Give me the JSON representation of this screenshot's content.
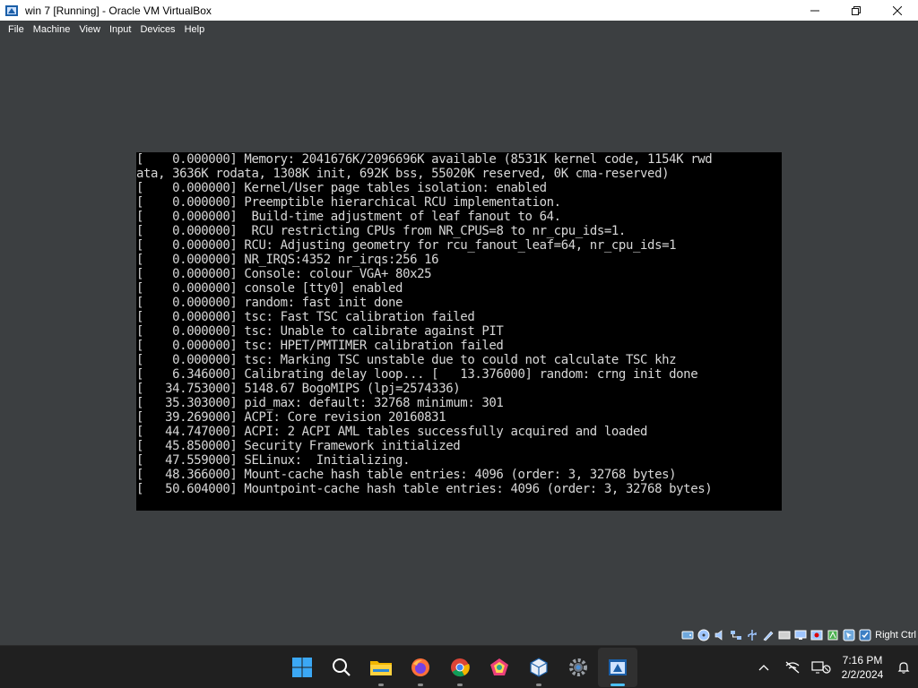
{
  "window": {
    "title": "win 7 [Running] - Oracle VM VirtualBox",
    "controls": [
      "minimize-icon",
      "restore-icon",
      "close-icon"
    ]
  },
  "menu": [
    "File",
    "Machine",
    "View",
    "Input",
    "Devices",
    "Help"
  ],
  "console": {
    "lines": [
      "[    0.000000] Memory: 2041676K/2096696K available (8531K kernel code, 1154K rwd",
      "ata, 3636K rodata, 1308K init, 692K bss, 55020K reserved, 0K cma-reserved)",
      "[    0.000000] Kernel/User page tables isolation: enabled",
      "[    0.000000] Preemptible hierarchical RCU implementation.",
      "[    0.000000] \tBuild-time adjustment of leaf fanout to 64.",
      "[    0.000000] \tRCU restricting CPUs from NR_CPUS=8 to nr_cpu_ids=1.",
      "[    0.000000] RCU: Adjusting geometry for rcu_fanout_leaf=64, nr_cpu_ids=1",
      "[    0.000000] NR_IRQS:4352 nr_irqs:256 16",
      "[    0.000000] Console: colour VGA+ 80x25",
      "[    0.000000] console [tty0] enabled",
      "[    0.000000] random: fast init done",
      "[    0.000000] tsc: Fast TSC calibration failed",
      "[    0.000000] tsc: Unable to calibrate against PIT",
      "[    0.000000] tsc: HPET/PMTIMER calibration failed",
      "[    0.000000] tsc: Marking TSC unstable due to could not calculate TSC khz",
      "[    6.346000] Calibrating delay loop... [   13.376000] random: crng init done",
      "[   34.753000] 5148.67 BogoMIPS (lpj=2574336)",
      "[   35.303000] pid_max: default: 32768 minimum: 301",
      "[   39.269000] ACPI: Core revision 20160831",
      "[   44.747000] ACPI: 2 ACPI AML tables successfully acquired and loaded",
      "[   45.850000] Security Framework initialized",
      "[   47.559000] SELinux:  Initializing.",
      "[   48.366000] Mount-cache hash table entries: 4096 (order: 3, 32768 bytes)",
      "[   50.604000] Mountpoint-cache hash table entries: 4096 (order: 3, 32768 bytes)"
    ]
  },
  "statusbar": {
    "icons": [
      "hard-disk-icon",
      "optical-drive-icon",
      "audio-icon",
      "network-icon",
      "usb-icon",
      "shared-folders-icon",
      "display-icon",
      "video-capture-icon",
      "recording-icon",
      "cpu-icon",
      "mouse-integration-icon"
    ],
    "host_key": "Right Ctrl"
  },
  "taskbar": {
    "apps": [
      "windows-start-icon",
      "search-icon",
      "file-explorer-icon",
      "firefox-icon",
      "chrome-icon",
      "paint-app-icon",
      "virtualbox-icon",
      "settings-icon",
      "vm-window-icon"
    ],
    "tray_icons": [
      "chevron-up-icon",
      "network-off-icon",
      "display-sound-icon"
    ],
    "time": "7:16 PM",
    "date": "2/2/2024"
  }
}
